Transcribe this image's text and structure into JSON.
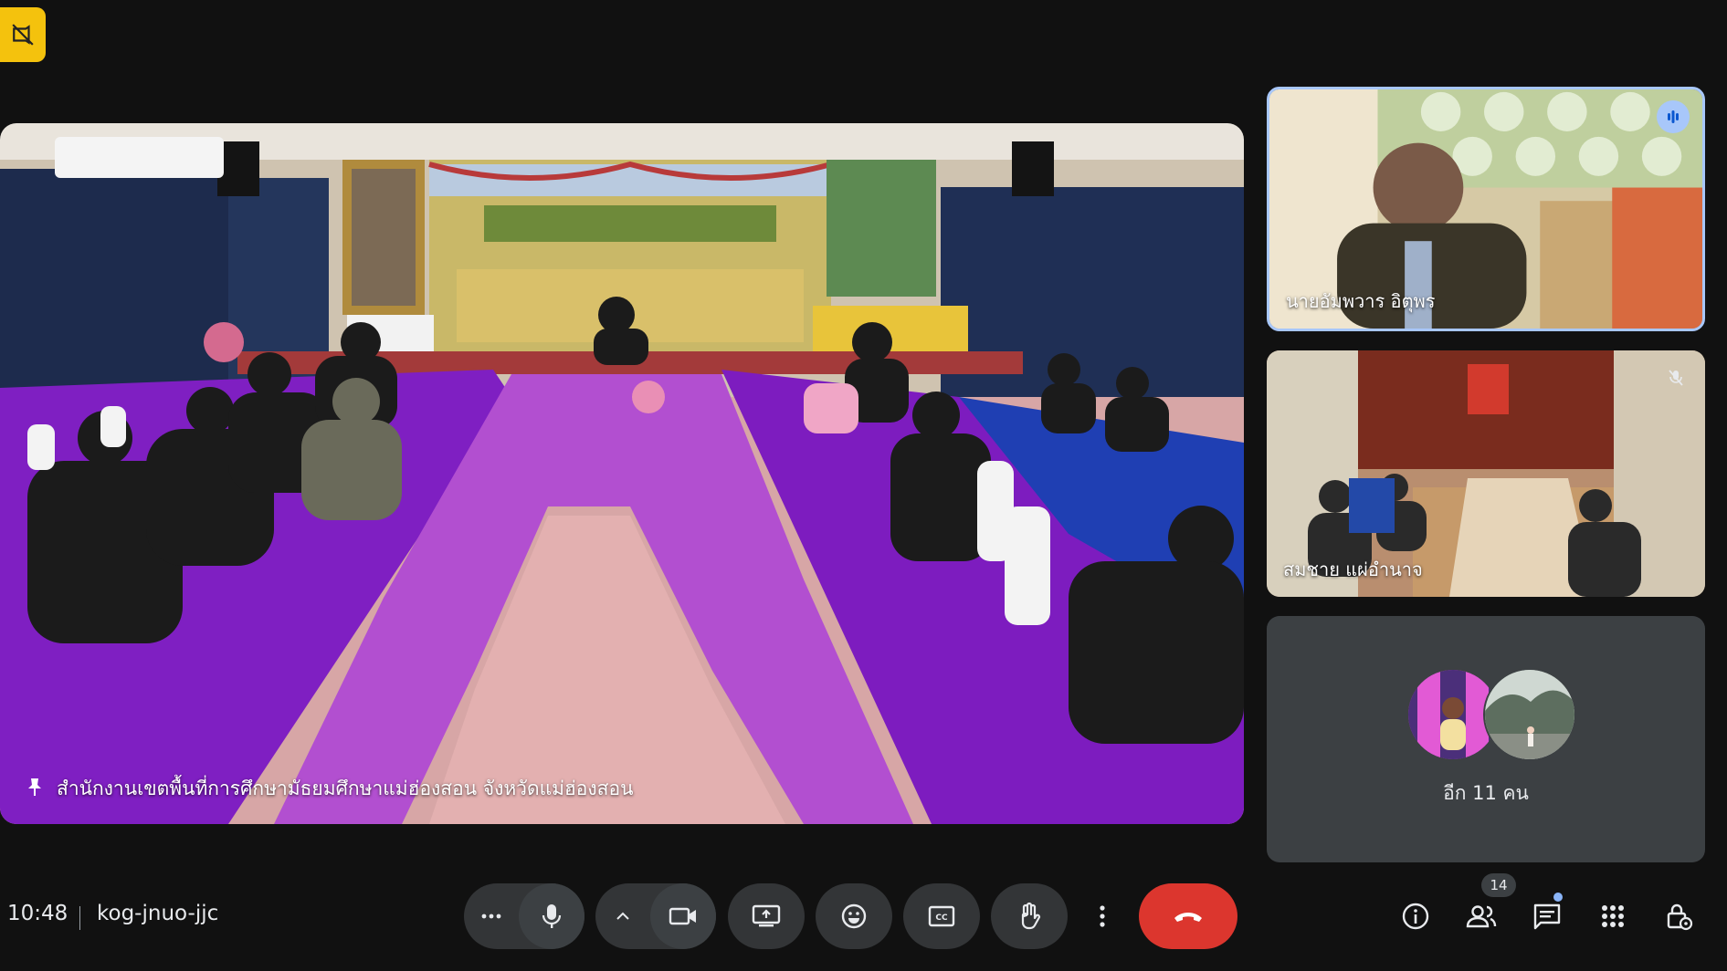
{
  "main_tile": {
    "caption": "สำนักงานเขตพื้นที่การศึกษามัธยมศึกษาแม่ฮ่องสอน จังหวัดแม่ฮ่องสอน",
    "pin_icon": "pin-icon"
  },
  "participants": {
    "speaker_name": "นายอัมพวาร อิตุพร",
    "room_name": "สมชาย แผ่อำนาจ",
    "others_label": "อีก 11 คน"
  },
  "bottom_bar": {
    "time": "10:48",
    "meeting_code": "kog-jnuo-jjc",
    "participant_count": "14"
  },
  "controls": {
    "more_options": "more-horiz-icon",
    "mic": "mic-icon",
    "camera_options": "chevron-up-icon",
    "camera": "videocam-icon",
    "present": "present-screen-icon",
    "reactions": "emoji-icon",
    "captions": "closed-caption-icon",
    "raise_hand": "hand-icon",
    "more_vert": "more-vert-icon",
    "leave": "call-end-icon"
  },
  "right_panel_icons": [
    "info-icon",
    "people-icon",
    "chat-icon",
    "activities-icon",
    "host-controls-icon"
  ],
  "colors": {
    "background": "#111111",
    "leave_red": "#dc362e",
    "badge_yellow": "#f4c20d",
    "speaker_border": "#a8c7fa",
    "control_bg": "#333537"
  }
}
